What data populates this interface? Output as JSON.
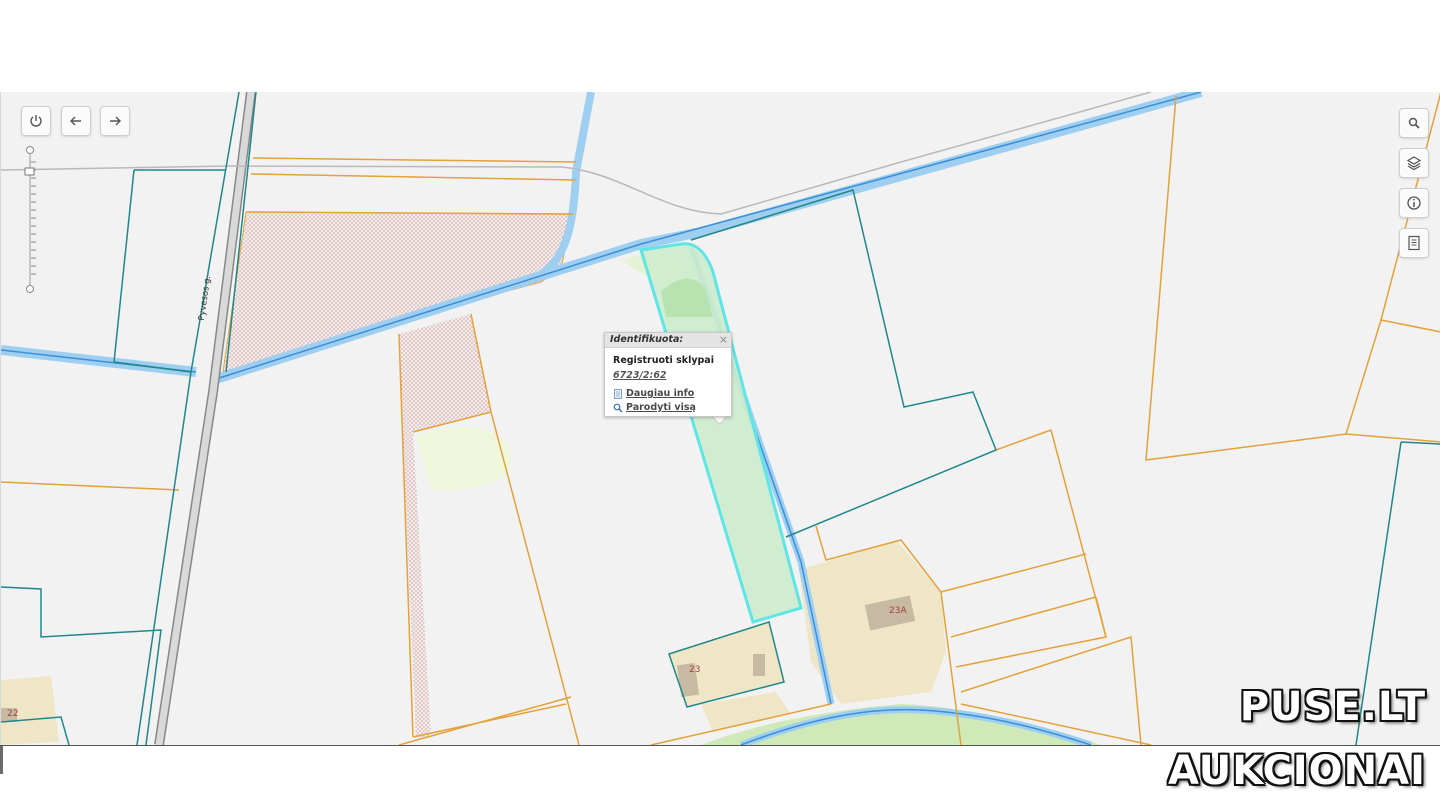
{
  "map": {
    "road_label": "Pyvesos g.",
    "house_labels": [
      "23",
      "23A",
      "22"
    ]
  },
  "controls": {
    "left": [
      {
        "name": "power-icon",
        "label": "power"
      },
      {
        "name": "arrow-left-icon",
        "label": "back"
      },
      {
        "name": "arrow-right-icon",
        "label": "forward"
      }
    ],
    "right": [
      {
        "name": "search-icon"
      },
      {
        "name": "layers-icon"
      },
      {
        "name": "info-icon"
      },
      {
        "name": "document-icon"
      }
    ]
  },
  "popup": {
    "title": "Identifikuota:",
    "close": "×",
    "layer": "Registruoti sklypai",
    "parcel_id": "6723/2:62",
    "more_info": "Daugiau info",
    "show_all": "Parodyti visą"
  },
  "watermark": {
    "line1": "PUSE.LT",
    "line2": "AUKCIONAI"
  },
  "colors": {
    "map_bg": "#f2f2f2",
    "water": "#9ecff0",
    "parcel_orange": "#e3a23a",
    "parcel_teal": "#21878a",
    "highlight_fill": "#cdeccd",
    "highlight_stroke": "#5ee6e6",
    "building_area": "#efe6c8",
    "building": "#c8b9a2"
  }
}
